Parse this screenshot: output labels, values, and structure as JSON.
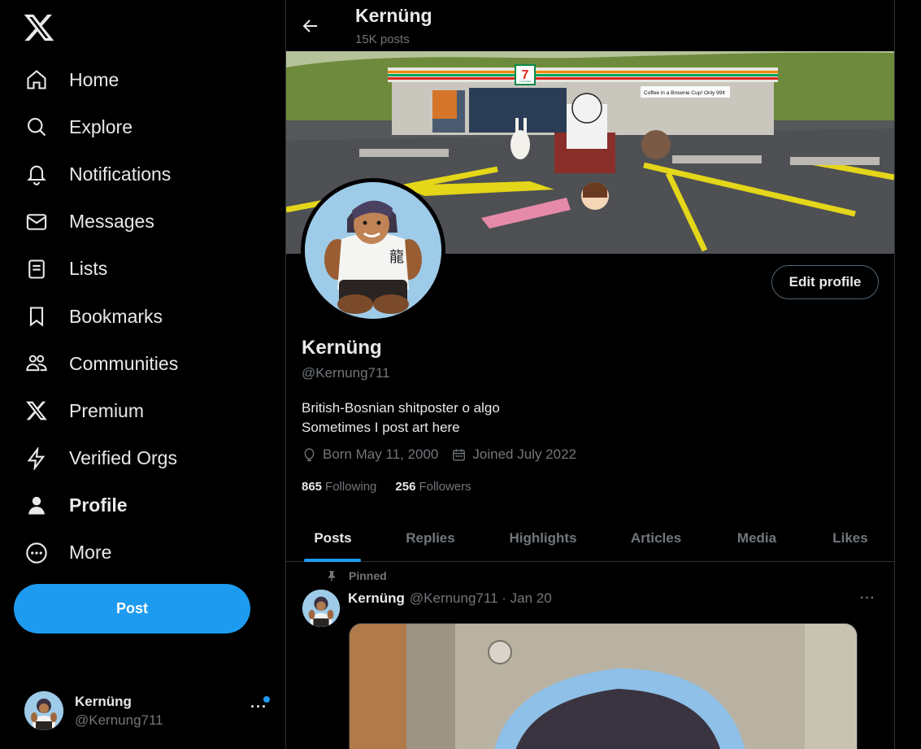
{
  "sidebar": {
    "logo": "x-logo-icon",
    "items": [
      {
        "label": "Home",
        "icon": "home-icon"
      },
      {
        "label": "Explore",
        "icon": "search-icon"
      },
      {
        "label": "Notifications",
        "icon": "bell-icon"
      },
      {
        "label": "Messages",
        "icon": "envelope-icon"
      },
      {
        "label": "Lists",
        "icon": "list-icon"
      },
      {
        "label": "Bookmarks",
        "icon": "bookmark-icon"
      },
      {
        "label": "Communities",
        "icon": "people-icon"
      },
      {
        "label": "Premium",
        "icon": "x-logo-icon"
      },
      {
        "label": "Verified Orgs",
        "icon": "lightning-icon"
      },
      {
        "label": "Profile",
        "icon": "person-icon",
        "active": true
      },
      {
        "label": "More",
        "icon": "more-circle-icon"
      }
    ],
    "post_button": "Post",
    "account": {
      "name": "Kernüng",
      "handle": "@Kernung711",
      "more": "···"
    }
  },
  "header": {
    "title": "Kernüng",
    "subtitle": "15K posts"
  },
  "profile": {
    "name": "Kernüng",
    "handle": "@Kernung711",
    "bio_line1": "British-Bosnian shitposter o algo",
    "bio_line2": "Sometimes I post art here",
    "born": "Born May 11, 2000",
    "joined": "Joined July 2022",
    "following_count": "865",
    "following_label": "Following",
    "followers_count": "256",
    "followers_label": "Followers",
    "edit_button": "Edit profile",
    "banner_sign_1": "7 ELEVEN",
    "banner_sign_2": "Coffee in a Brownie Cup! Only 99¢"
  },
  "tabs": [
    {
      "label": "Posts",
      "active": true
    },
    {
      "label": "Replies"
    },
    {
      "label": "Highlights"
    },
    {
      "label": "Articles"
    },
    {
      "label": "Media"
    },
    {
      "label": "Likes"
    }
  ],
  "pinned_post": {
    "pinned_label": "Pinned",
    "author": "Kernüng",
    "handle_date": "@Kernung711 · Jan 20",
    "more": "···"
  },
  "colors": {
    "accent": "#1d9bf0",
    "background": "#000000",
    "secondary_text": "#71767b",
    "border": "#2f3336"
  }
}
